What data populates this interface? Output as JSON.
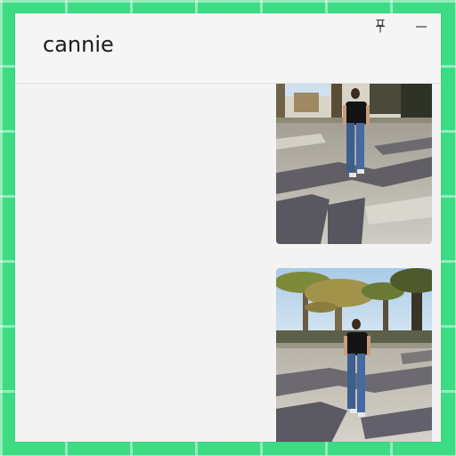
{
  "window": {
    "title": "cannie"
  },
  "controls": {
    "pin_icon": "pin-icon",
    "minimize_icon": "minimize-icon"
  },
  "messages": [
    {
      "type": "image",
      "description": "photo"
    },
    {
      "type": "image",
      "description": "photo"
    }
  ],
  "colors": {
    "desktop_bg": "#3ddc84",
    "window_bg": "#f3f3f3",
    "header_bg": "#f5f5f5"
  }
}
